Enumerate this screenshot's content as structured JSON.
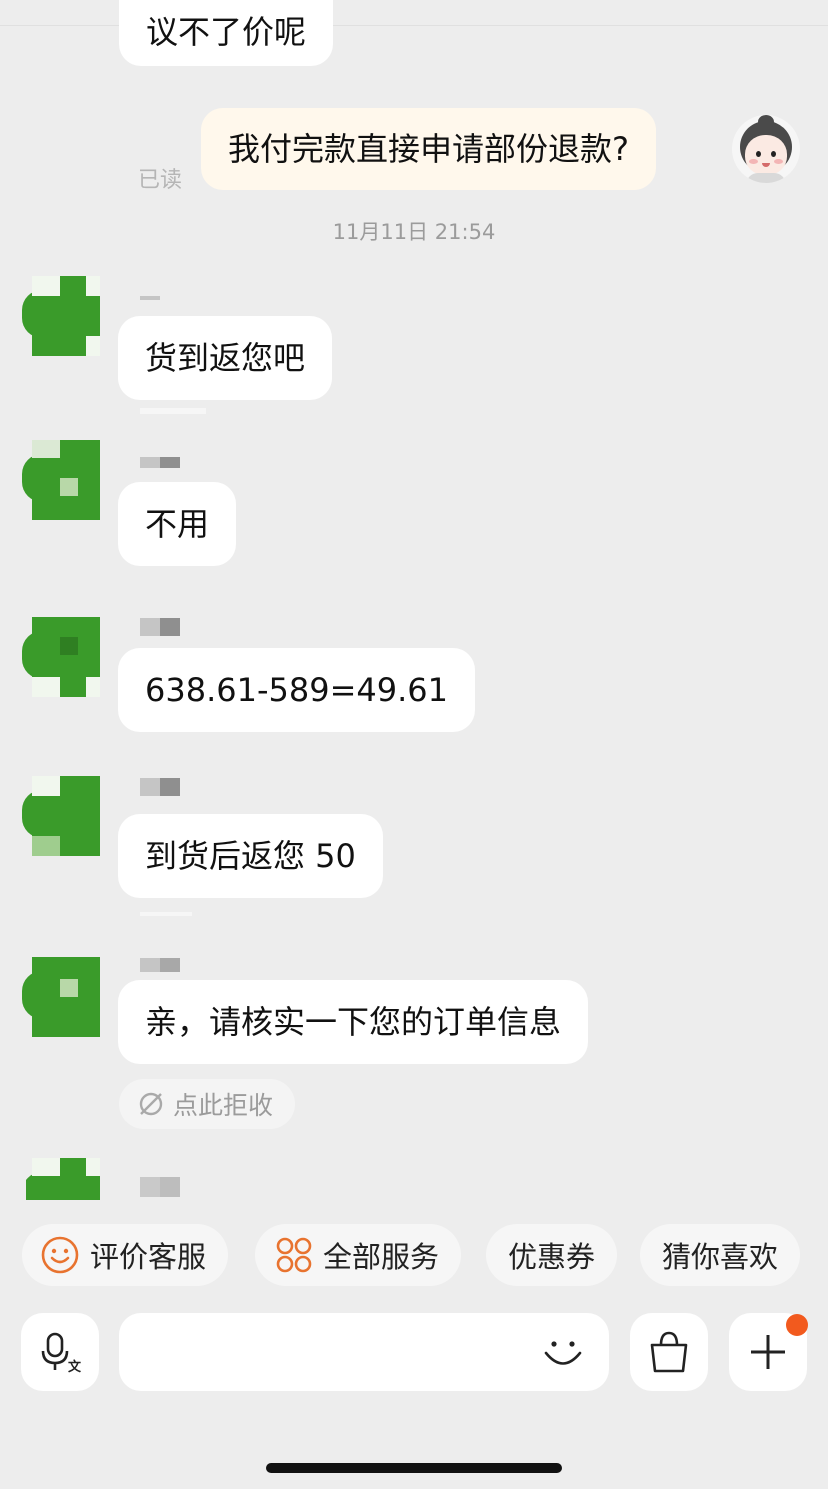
{
  "messages": {
    "cut_top": "议不了价呢",
    "mine": "我付完款直接申请部份退款?",
    "read_status": "已读",
    "timestamp": "11月11日 21:54",
    "m1": "货到返您吧",
    "m2": "不用",
    "m3": "638.61-589=49.61",
    "m4": "到货后返您 50",
    "m5": "亲，请核实一下您的订单信息"
  },
  "reject_label": "点此拒收",
  "quick_actions": [
    {
      "label": "评价客服",
      "icon": "smile-icon"
    },
    {
      "label": "全部服务",
      "icon": "grid-circles-icon"
    },
    {
      "label": "优惠券"
    },
    {
      "label": "猜你喜欢"
    }
  ],
  "input": {
    "placeholder": "",
    "voice_icon": "voice-to-text-icon",
    "emoji_icon": "emoji-icon",
    "bag_icon": "shopping-bag-icon",
    "plus_icon": "plus-icon"
  },
  "colors": {
    "background": "#ededed",
    "mine_bubble": "#fff8ec",
    "accent": "#f25a1e",
    "avatar_green": "#3a9b2a"
  }
}
